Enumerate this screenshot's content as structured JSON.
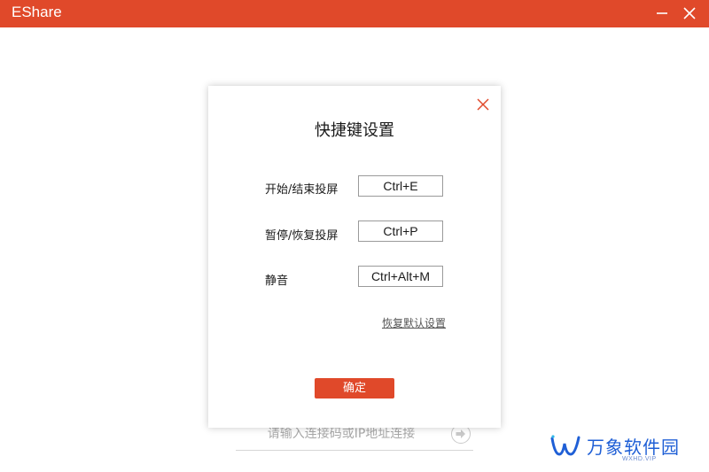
{
  "window": {
    "title": "EShare",
    "minimize_icon": "minimize-icon",
    "close_icon": "close-icon"
  },
  "connect": {
    "placeholder": "请输入连接码或IP地址连接",
    "go_icon": "arrow-right-circle-icon"
  },
  "dialog": {
    "title": "快捷键设置",
    "close_icon": "close-icon",
    "rows": [
      {
        "label": "开始/结束投屏",
        "key": "Ctrl+E"
      },
      {
        "label": "暂停/恢复投屏",
        "key": "Ctrl+P"
      },
      {
        "label": "静音",
        "key": "Ctrl+Alt+M"
      }
    ],
    "restore_label": "恢复默认设置",
    "confirm_label": "确定"
  },
  "watermark": {
    "text": "万象软件园",
    "sub": "WXHD.VIP"
  },
  "colors": {
    "accent": "#e0492a",
    "watermark": "#1f5fd6"
  }
}
